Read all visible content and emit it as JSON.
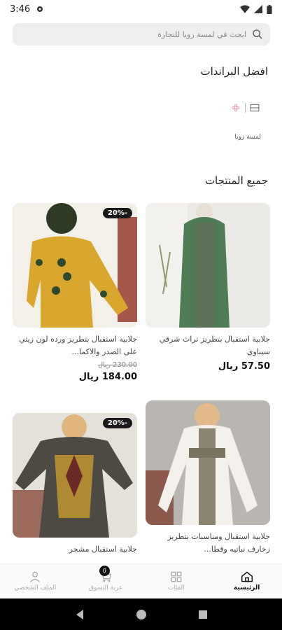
{
  "status": {
    "time": "3:46"
  },
  "search": {
    "placeholder": "ابحث في لمسة زويا للتجارة"
  },
  "brands": {
    "title": "افضل البراندات",
    "items": [
      {
        "name": "لمسة زويا"
      }
    ]
  },
  "products": {
    "title": "جميع المنتجات",
    "items": [
      {
        "title": "جلابية استقبال بتطريز تراث شرقي سيناوي",
        "old_price": "",
        "price": "57.50",
        "currency": "ريال",
        "discount": ""
      },
      {
        "title": "جلابية استقبال بتطريز ورده لون زيتي على الصدر والاكما...",
        "old_price": "230.00",
        "price": "184.00",
        "currency": "ريال",
        "discount": "20%-"
      },
      {
        "title": "جلابية استقبال ومناسبات بتطريز زخارف نباتيه وقطا...",
        "old_price": "",
        "price": "",
        "currency": "",
        "discount": ""
      },
      {
        "title": "جلابية استقبال مشجر",
        "old_price": "",
        "price": "",
        "currency": "",
        "discount": "20%-"
      }
    ]
  },
  "nav": {
    "items": [
      {
        "label": "الرئيسية",
        "icon": "home-icon",
        "active": true
      },
      {
        "label": "الفئات",
        "icon": "grid-icon",
        "active": false
      },
      {
        "label": "عربة التسوق",
        "icon": "cart-icon",
        "active": false,
        "badge": "0"
      },
      {
        "label": "الملف الشخصي",
        "icon": "user-icon",
        "active": false
      }
    ]
  },
  "colors": {
    "accent": "#111111",
    "search_bg": "#eeeeef"
  }
}
